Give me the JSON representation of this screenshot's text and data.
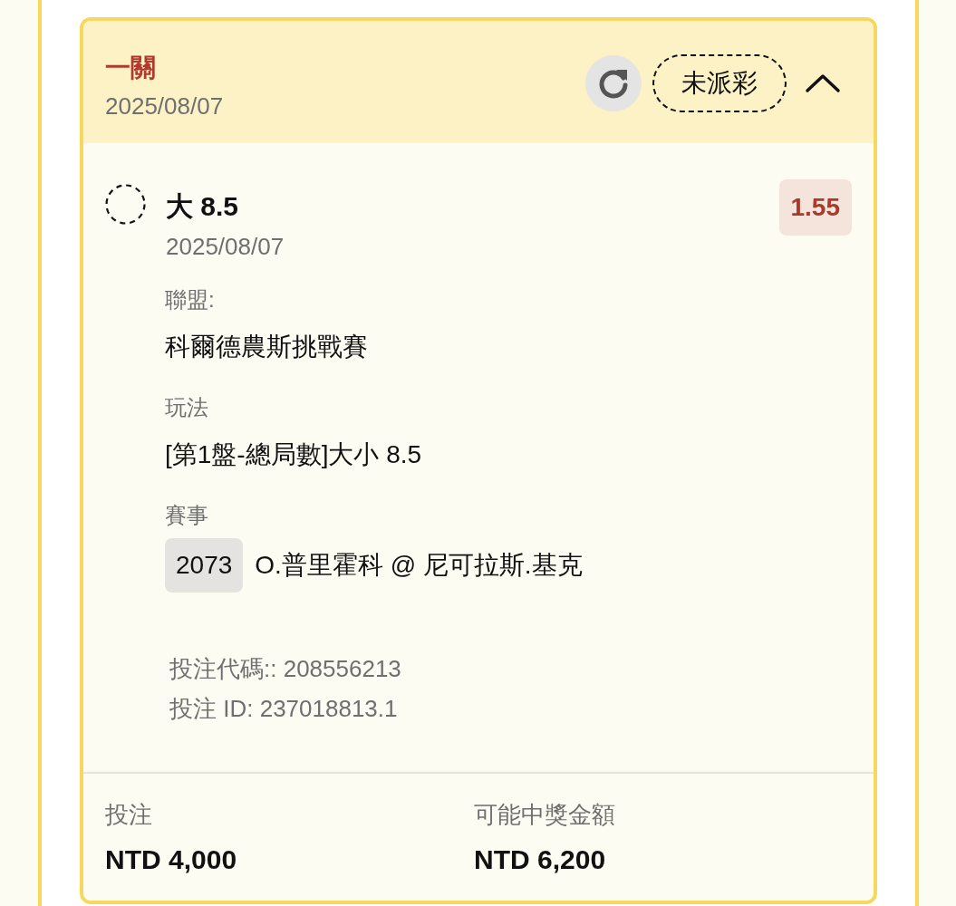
{
  "bet": {
    "title": "一關",
    "date": "2025/08/07",
    "status": "未派彩",
    "expanded": true
  },
  "selection": {
    "name": "大 8.5",
    "date": "2025/08/07",
    "odds": "1.55"
  },
  "details": [
    {
      "kind": "text",
      "label": "聯盟:",
      "value": "科爾德農斯挑戰賽"
    },
    {
      "kind": "text",
      "label": "玩法",
      "value": "[第1盤-總局數]大小 8.5"
    },
    {
      "kind": "event",
      "label": "賽事",
      "code": "2073",
      "value": "O.普里霍科 @ 尼可拉斯.基克"
    }
  ],
  "references": [
    "投注代碼:: 208556213",
    "投注 ID: 237018813.1"
  ],
  "summary": [
    {
      "label": "投注",
      "amount": "NTD 4,000"
    },
    {
      "label": "可能中獎金額",
      "amount": "NTD 6,200"
    }
  ]
}
